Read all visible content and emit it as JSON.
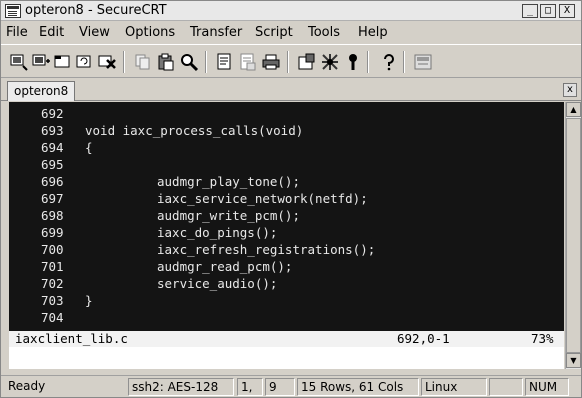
{
  "window": {
    "title": "opteron8 - SecureCRT",
    "buttons": {
      "minimize": "_",
      "maximize": "□",
      "close": "X"
    }
  },
  "menu": [
    "File",
    "Edit",
    "View",
    "Options",
    "Transfer",
    "Script",
    "Tools",
    "Help"
  ],
  "toolbar": [
    "connect-icon",
    "quick-connect-icon",
    "connect-tab-icon",
    "reconnect-icon",
    "disconnect-icon",
    "copy-icon",
    "paste-icon",
    "find-icon",
    "print-icon",
    "print-selection-icon",
    "printer-icon",
    "session-options-icon",
    "global-options-icon",
    "keymap-icon",
    "help-icon",
    "sftp-icon"
  ],
  "tab": {
    "label": "opteron8",
    "close": "x"
  },
  "terminal": {
    "lines": [
      {
        "num": "692",
        "code": "",
        "indent": false
      },
      {
        "num": "693",
        "code": "void iaxc_process_calls(void)",
        "indent": false
      },
      {
        "num": "694",
        "code": "{",
        "indent": false
      },
      {
        "num": "695",
        "code": "",
        "indent": false
      },
      {
        "num": "696",
        "code": "audmgr_play_tone();",
        "indent": true
      },
      {
        "num": "697",
        "code": "iaxc_service_network(netfd);",
        "indent": true
      },
      {
        "num": "698",
        "code": "audmgr_write_pcm();",
        "indent": true
      },
      {
        "num": "699",
        "code": "iaxc_do_pings();",
        "indent": true
      },
      {
        "num": "700",
        "code": "iaxc_refresh_registrations();",
        "indent": true
      },
      {
        "num": "701",
        "code": "audmgr_read_pcm();",
        "indent": true
      },
      {
        "num": "702",
        "code": "service_audio();",
        "indent": true
      },
      {
        "num": "703",
        "code": "}",
        "indent": false
      },
      {
        "num": "704",
        "code": "",
        "indent": false
      }
    ],
    "status": {
      "file": "iaxclient_lib.c",
      "position": "692,0-1",
      "percent": "73%"
    }
  },
  "statusbar": {
    "ready": "Ready",
    "protocol": "ssh2: AES-128",
    "row": "1,",
    "col": "9",
    "size": "15 Rows, 61 Cols",
    "os": "Linux",
    "extra": "",
    "num": "NUM"
  }
}
